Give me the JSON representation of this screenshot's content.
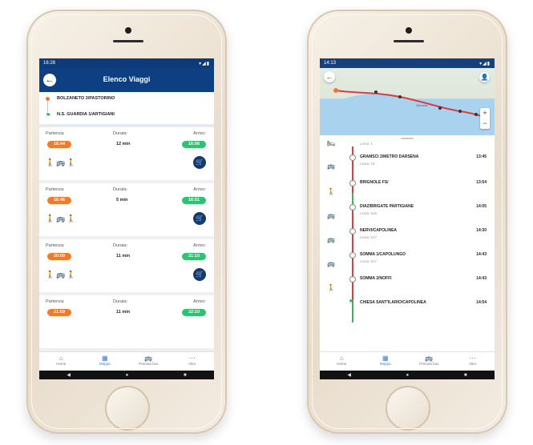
{
  "left_screen": {
    "status_time": "16:28",
    "status_icons": "▾◢▮",
    "title": "Elenco Viaggi",
    "route": {
      "from": "BOLZANETO 3/PASTORINO",
      "to": "N.S. GUARDIA 1/ARTIGIANI"
    },
    "labels": {
      "departure": "Partenza:",
      "duration": "Durata:",
      "arrival": "Arrivo:"
    },
    "trips": [
      {
        "departure": "16:44",
        "duration": "12 min",
        "arrival": "16:56",
        "modes": "🚶🚌🚶"
      },
      {
        "departure": "16:46",
        "duration": "5 min",
        "arrival": "16:51",
        "modes": "🚶🚌🚶"
      },
      {
        "departure": "20:09",
        "duration": "11 min",
        "arrival": "21:10",
        "modes": "🚶🚌🚶"
      },
      {
        "departure": "21:59",
        "duration": "11 min",
        "arrival": "22:10",
        "modes": ""
      }
    ],
    "nav": [
      {
        "label": "Home",
        "icon": "⌂"
      },
      {
        "label": "Mappa",
        "icon": "▦"
      },
      {
        "label": "Prenota bus",
        "icon": "🚌"
      },
      {
        "label": "Altro",
        "icon": "⋯"
      }
    ]
  },
  "right_screen": {
    "status_time": "14:13",
    "status_icons": "▾◢▮",
    "map_place": "Genova",
    "first_line": "Linea: 1",
    "stops": [
      {
        "name": "GRAMSCI 2/METRO DARSENA",
        "time": "13:45",
        "sub": "Linea: 18",
        "icon": "🚌"
      },
      {
        "name": "BRIGNOLE FS/",
        "time": "13:54",
        "sub": "",
        "icon": "🚶"
      },
      {
        "name": "DIAZ/BRIGATE PARTIGIANE",
        "time": "14:05",
        "sub": "Linea: 516",
        "icon": "🚌"
      },
      {
        "name": "NERVI/CAPOLINEA",
        "time": "14:30",
        "sub": "Linea: 517",
        "icon": "🚌"
      },
      {
        "name": "SOMMA 1/CAPOLUNGO",
        "time": "14:43",
        "sub": "Linea: 517",
        "icon": "🚌"
      },
      {
        "name": "SOMMA 2/NOFFI",
        "time": "14:43",
        "sub": "",
        "icon": "🚶"
      },
      {
        "name": "CHIESA SANT'ILARIO/CAPOLINEA",
        "time": "14:54",
        "sub": "",
        "icon": ""
      }
    ],
    "nav": [
      {
        "label": "Home",
        "icon": "⌂"
      },
      {
        "label": "Mappa",
        "icon": "▦"
      },
      {
        "label": "Prenota bus",
        "icon": "🚌"
      },
      {
        "label": "Altro",
        "icon": "⋯"
      }
    ]
  },
  "colors": {
    "primary": "#0e3f82",
    "departure": "#f47a2a",
    "arrival": "#2fc36f",
    "route_line": "#e03b3b"
  }
}
